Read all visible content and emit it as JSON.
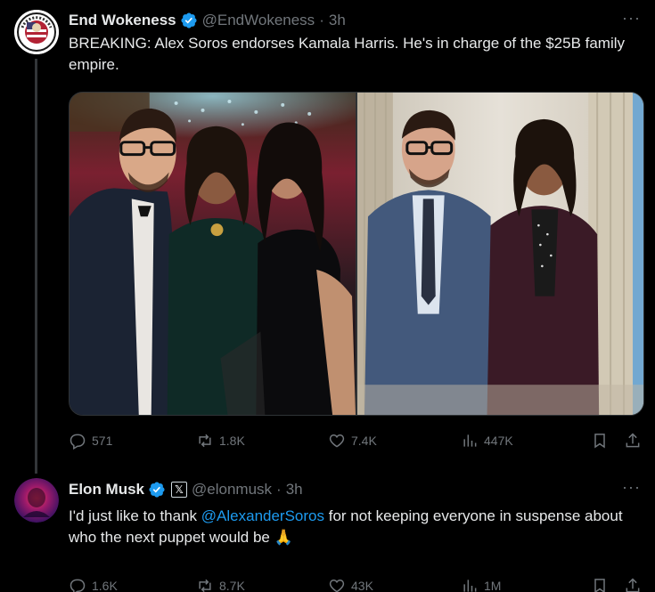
{
  "tweets": [
    {
      "name": "End Wokeness",
      "handle": "@EndWokeness",
      "time": "3h",
      "more": "···",
      "text": "BREAKING: Alex Soros endorses Kamala Harris. He's in charge of the $25B family empire.",
      "stats": {
        "replies": "571",
        "reposts": "1.8K",
        "likes": "7.4K",
        "views": "447K"
      }
    },
    {
      "name": "Elon Musk",
      "badge": "𝕏",
      "handle": "@elonmusk",
      "time": "3h",
      "more": "···",
      "text_before": "I'd just like to thank ",
      "mention": "@AlexanderSoros",
      "text_after": " for not keeping everyone in suspense about who the next puppet would be 🙏",
      "stats": {
        "replies": "1.6K",
        "reposts": "8.7K",
        "likes": "43K",
        "views": "1M"
      }
    }
  ],
  "colors": {
    "background": "#000000",
    "text": "#e7e9ea",
    "muted": "#71767b",
    "link": "#1d9bf0",
    "verified": "#1d9bf0"
  },
  "icons": [
    "verified-icon",
    "more-icon",
    "reply-icon",
    "repost-icon",
    "like-icon",
    "views-icon",
    "bookmark-icon",
    "share-icon"
  ]
}
